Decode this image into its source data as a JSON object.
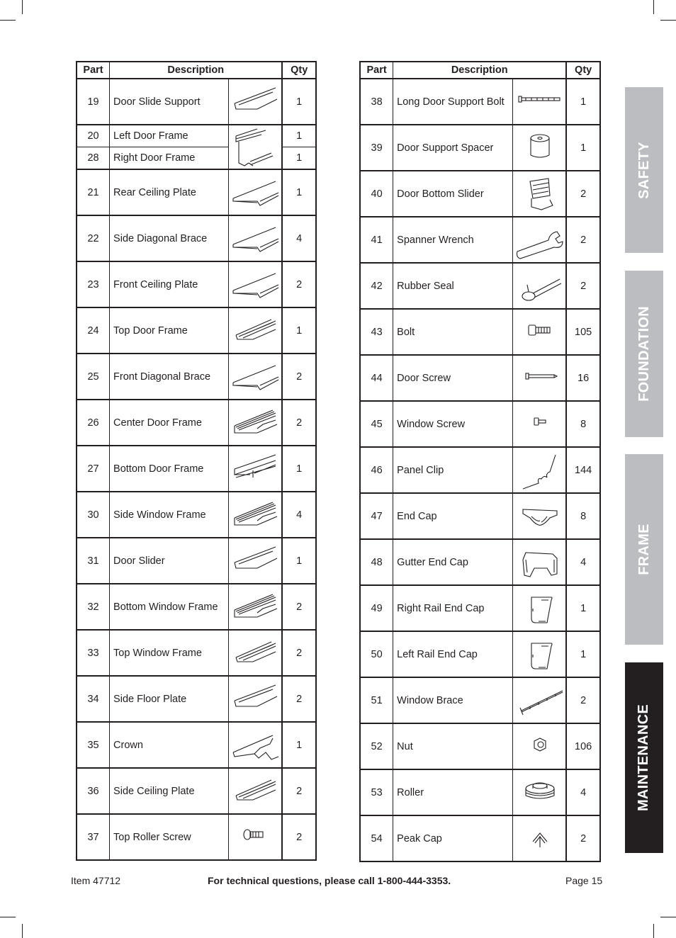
{
  "left_table": {
    "headers": {
      "part": "Part",
      "description": "Description",
      "qty": "Qty"
    },
    "rows": [
      {
        "part": "19",
        "description": "Door Slide Support",
        "icon": "angle-rail-icon",
        "qty": "1"
      },
      {
        "part": "20",
        "description": "Left Door Frame",
        "icon": "door-frame-icon",
        "qty": "1"
      },
      {
        "part": "28",
        "description": "Right Door Frame",
        "icon": "door-frame-icon",
        "qty": "1"
      },
      {
        "part": "21",
        "description": "Rear Ceiling Plate",
        "icon": "flat-plate-icon",
        "qty": "1"
      },
      {
        "part": "22",
        "description": "Side Diagonal Brace",
        "icon": "flat-plate-icon",
        "qty": "4"
      },
      {
        "part": "23",
        "description": "Front Ceiling Plate",
        "icon": "flat-plate-icon",
        "qty": "2"
      },
      {
        "part": "24",
        "description": "Top Door Frame",
        "icon": "channel-rail-icon",
        "qty": "1"
      },
      {
        "part": "25",
        "description": "Front Diagonal Brace",
        "icon": "flat-plate-icon",
        "qty": "2"
      },
      {
        "part": "26",
        "description": "Center Door Frame",
        "icon": "ribbed-rail-icon",
        "qty": "2"
      },
      {
        "part": "27",
        "description": "Bottom Door Frame",
        "icon": "double-channel-icon",
        "qty": "1"
      },
      {
        "part": "30",
        "description": "Side Window Frame",
        "icon": "ribbed-rail-icon",
        "qty": "4"
      },
      {
        "part": "31",
        "description": "Door Slider",
        "icon": "angle-rail-icon",
        "qty": "1"
      },
      {
        "part": "32",
        "description": "Bottom Window Frame",
        "icon": "ribbed-rail-icon",
        "qty": "2"
      },
      {
        "part": "33",
        "description": "Top Window Frame",
        "icon": "channel-rail-icon",
        "qty": "2"
      },
      {
        "part": "34",
        "description": "Side Floor Plate",
        "icon": "angle-rail-icon",
        "qty": "2"
      },
      {
        "part": "35",
        "description": "Crown",
        "icon": "crown-rail-icon",
        "qty": "1"
      },
      {
        "part": "36",
        "description": "Side Ceiling Plate",
        "icon": "channel-rail-icon",
        "qty": "2"
      },
      {
        "part": "37",
        "description": "Top Roller Screw",
        "icon": "screw-icon",
        "qty": "2"
      }
    ]
  },
  "right_table": {
    "headers": {
      "part": "Part",
      "description": "Description",
      "qty": "Qty"
    },
    "rows": [
      {
        "part": "38",
        "description": "Long Door Support Bolt",
        "icon": "long-bolt-icon",
        "qty": "1"
      },
      {
        "part": "39",
        "description": "Door Support Spacer",
        "icon": "spacer-icon",
        "qty": "1"
      },
      {
        "part": "40",
        "description": "Door Bottom Slider",
        "icon": "slider-block-icon",
        "qty": "2"
      },
      {
        "part": "41",
        "description": "Spanner Wrench",
        "icon": "wrench-icon",
        "qty": "2"
      },
      {
        "part": "42",
        "description": "Rubber Seal",
        "icon": "seal-ring-icon",
        "qty": "2"
      },
      {
        "part": "43",
        "description": "Bolt",
        "icon": "bolt-icon",
        "qty": "105"
      },
      {
        "part": "44",
        "description": "Door Screw",
        "icon": "long-screw-icon",
        "qty": "16"
      },
      {
        "part": "45",
        "description": "Window Screw",
        "icon": "small-screw-icon",
        "qty": "8"
      },
      {
        "part": "46",
        "description": "Panel Clip",
        "icon": "wire-clip-icon",
        "qty": "144"
      },
      {
        "part": "47",
        "description": "End Cap",
        "icon": "end-cap-icon",
        "qty": "8"
      },
      {
        "part": "48",
        "description": "Gutter End Cap",
        "icon": "gutter-cap-icon",
        "qty": "4"
      },
      {
        "part": "49",
        "description": "Right Rail End Cap",
        "icon": "rail-cap-icon",
        "qty": "1"
      },
      {
        "part": "50",
        "description": "Left Rail End Cap",
        "icon": "rail-cap-icon",
        "qty": "1"
      },
      {
        "part": "51",
        "description": "Window Brace",
        "icon": "brace-rod-icon",
        "qty": "2"
      },
      {
        "part": "52",
        "description": "Nut",
        "icon": "nut-icon",
        "qty": "106"
      },
      {
        "part": "53",
        "description": "Roller",
        "icon": "roller-icon",
        "qty": "4"
      },
      {
        "part": "54",
        "description": "Peak Cap",
        "icon": "peak-cap-icon",
        "qty": "2"
      }
    ]
  },
  "side_tabs": [
    {
      "label": "SAFETY",
      "active": false
    },
    {
      "label": "FOUNDATION",
      "active": false
    },
    {
      "label": "FRAME",
      "active": false
    },
    {
      "label": "MAINTENANCE",
      "active": true
    }
  ],
  "footer": {
    "item": "Item 47712",
    "support": "For technical questions, please call 1-800-444-3353.",
    "page": "Page 15"
  },
  "colors": {
    "tab_inactive": "#bcbdc0",
    "tab_active": "#231f20",
    "text": "#231f20"
  }
}
